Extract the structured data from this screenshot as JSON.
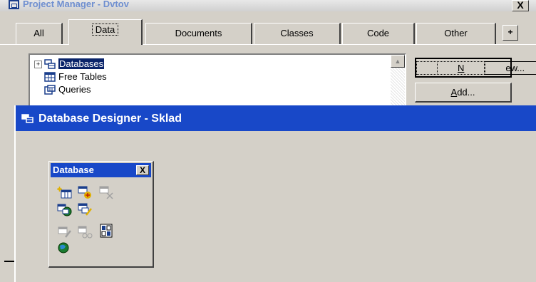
{
  "project_manager": {
    "title": "Project Manager - Dvtov",
    "close_label": "X",
    "tabs": [
      {
        "label": "All"
      },
      {
        "label": "Data"
      },
      {
        "label": "Documents"
      },
      {
        "label": "Classes"
      },
      {
        "label": "Code"
      },
      {
        "label": "Other"
      }
    ],
    "more_label": "+",
    "tree": [
      {
        "label": "Databases",
        "icon": "database-icon",
        "selected": true,
        "expander": "+"
      },
      {
        "label": "Free Tables",
        "icon": "table-icon"
      },
      {
        "label": "Queries",
        "icon": "query-icon"
      }
    ],
    "buttons": {
      "new_label_u": "N",
      "new_label_rest": "ew...",
      "add_label_u": "A",
      "add_label_rest": "dd..."
    }
  },
  "database_designer": {
    "title": "Database Designer - Sklad",
    "toolbar": {
      "title": "Database",
      "close_label": "X",
      "buttons": [
        {
          "icon": "new-table-icon"
        },
        {
          "icon": "add-table-icon"
        },
        {
          "icon": "remove-table-icon"
        },
        {
          "icon": "new-remote-view-icon"
        },
        {
          "icon": "new-local-view-icon"
        },
        {
          "icon": "modify-table-icon"
        },
        {
          "icon": "browse-table-icon"
        },
        {
          "icon": "edit-stored-procedures-icon"
        },
        {
          "icon": "connections-icon"
        }
      ]
    }
  }
}
